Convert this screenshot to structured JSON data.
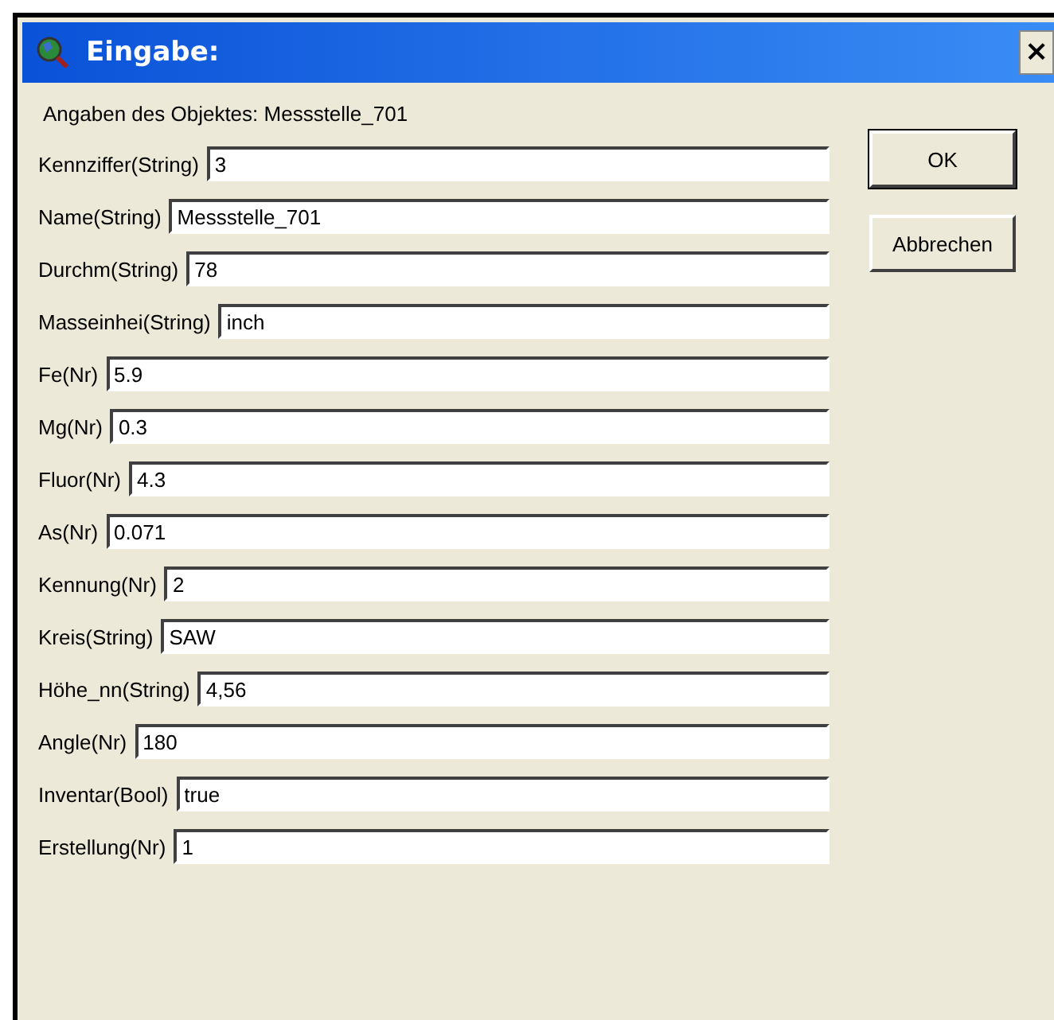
{
  "window": {
    "title": "Eingabe:",
    "close": "×"
  },
  "heading": "Angaben des Objektes: Messstelle_701",
  "fields": [
    {
      "label": "Kennziffer(String)",
      "value": "3"
    },
    {
      "label": "Name(String)",
      "value": "Messstelle_701"
    },
    {
      "label": "Durchm(String)",
      "value": "78"
    },
    {
      "label": "Masseinhei(String)",
      "value": "inch"
    },
    {
      "label": "Fe(Nr)",
      "value": "5.9"
    },
    {
      "label": "Mg(Nr)",
      "value": "0.3"
    },
    {
      "label": "Fluor(Nr)",
      "value": "4.3"
    },
    {
      "label": "As(Nr)",
      "value": "0.071"
    },
    {
      "label": "Kennung(Nr)",
      "value": "2"
    },
    {
      "label": "Kreis(String)",
      "value": "SAW"
    },
    {
      "label": "Höhe_nn(String)",
      "value": "4,56"
    },
    {
      "label": "Angle(Nr)",
      "value": "180"
    },
    {
      "label": "Inventar(Bool)",
      "value": "true"
    },
    {
      "label": "Erstellung(Nr)",
      "value": "1"
    }
  ],
  "buttons": [
    {
      "label": "OK",
      "default": true
    },
    {
      "label": "Abbrechen",
      "default": false
    }
  ]
}
